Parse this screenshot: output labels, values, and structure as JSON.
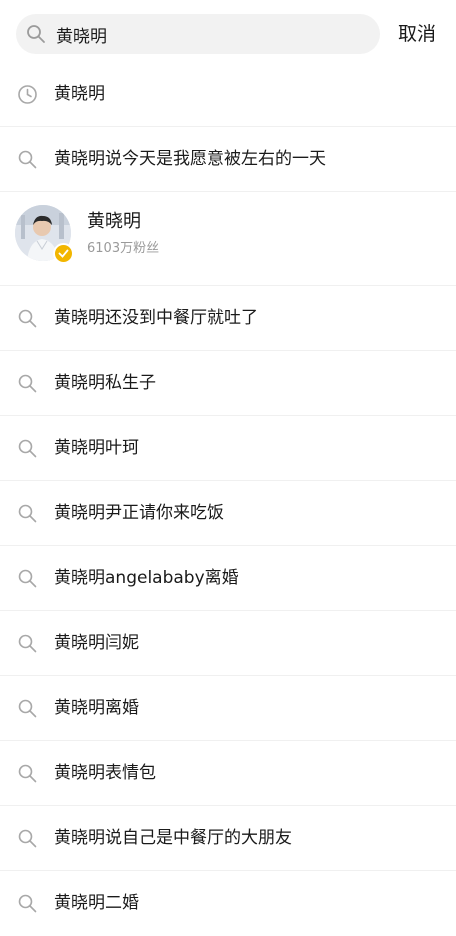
{
  "search": {
    "value": "黄晓明",
    "placeholder": ""
  },
  "header": {
    "cancel_label": "取消"
  },
  "history": {
    "icon": "clock-icon",
    "label": "黄晓明"
  },
  "suggestion_1": {
    "icon": "search-icon",
    "label": "黄晓明说今天是我愿意被左右的一天"
  },
  "user_result": {
    "name": "黄晓明",
    "fans": "6103万粉丝",
    "badge_color": "#f2b600"
  },
  "suggestions": [
    "黄晓明还没到中餐厅就吐了",
    "黄晓明私生子",
    "黄晓明叶珂",
    "黄晓明尹正请你来吃饭",
    "黄晓明angelababy离婚",
    "黄晓明闫妮",
    "黄晓明离婚",
    "黄晓明表情包",
    "黄晓明说自己是中餐厅的大朋友",
    "黄晓明二婚"
  ]
}
